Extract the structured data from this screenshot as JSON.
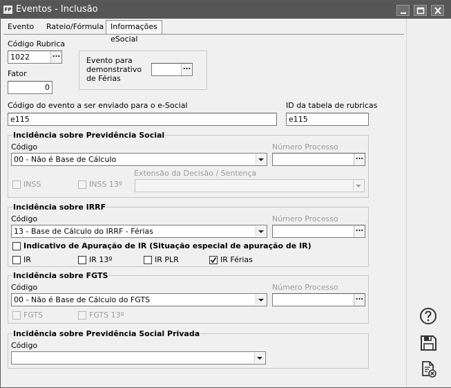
{
  "window": {
    "app_icon_text": "FP",
    "title": "Eventos - Inclusão"
  },
  "tabs": [
    {
      "label": "Evento"
    },
    {
      "label": "Rateio/Fórmula"
    },
    {
      "label": "Informações eSocial"
    }
  ],
  "form": {
    "codigo_rubrica_label": "Código Rubrica",
    "codigo_rubrica_value": "1022",
    "fator_label": "Fator",
    "fator_value": "0",
    "evento_ferias_label_1": "Evento para",
    "evento_ferias_label_2": "demonstrativo",
    "evento_ferias_label_3": "de Férias",
    "evento_ferias_value": "",
    "codigo_esocial_label": "Código do evento a ser enviado para o e-Social",
    "codigo_esocial_value": "e115",
    "id_tabela_label": "ID da tabela de rubricas",
    "id_tabela_value": "e115"
  },
  "previdencia": {
    "title": "Incidência sobre Previdência Social",
    "codigo_label": "Código",
    "codigo_value": "00 - Não é Base de Cálculo",
    "numero_processo_label": "Número Processo",
    "inss_label": "INSS",
    "inss13_label": "INSS 13º",
    "extensao_label": "Extensão da Decisão / Sentença"
  },
  "irrf": {
    "title": "Incidência sobre IRRF",
    "codigo_label": "Código",
    "codigo_value": "13 - Base de Cálculo do IRRF - Férias",
    "numero_processo_label": "Número Processo",
    "indicativo_label": "Indicativo de Apuração de IR (Situação especial de apuração de IR)",
    "ir_label": "IR",
    "ir13_label": "IR 13º",
    "irplr_label": "IR PLR",
    "irferias_label": "IR Férias",
    "irferias_checked": true
  },
  "fgts": {
    "title": "Incidência sobre FGTS",
    "codigo_label": "Código",
    "codigo_value": "00 - Não é Base de Cálculo do FGTS",
    "numero_processo_label": "Número Processo",
    "fgts_label": "FGTS",
    "fgts13_label": "FGTS 13º"
  },
  "previdencia_privada": {
    "title": "Incidência sobre Previdência Social Privada",
    "codigo_label": "Código",
    "codigo_value": ""
  },
  "sidebar": {
    "help_icon": "help-icon",
    "save_icon": "save-icon",
    "cancel_icon": "cancel-document-icon"
  }
}
